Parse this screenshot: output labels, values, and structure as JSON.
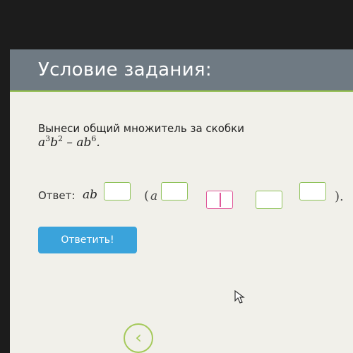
{
  "header": {
    "title": "Условие задания:"
  },
  "task": {
    "instruction": "Вынеси общий множитель за скобки",
    "expr": {
      "a1": "a",
      "e1": "3",
      "b1": "b",
      "e2": "2",
      "minus": " – ",
      "a2": "a",
      "b2": "b",
      "e3": "6",
      "dot": "."
    }
  },
  "answer": {
    "label": "Ответ:",
    "factor": "ab",
    "open_paren": "(",
    "inner_var": "a",
    "close_paren": ")."
  },
  "submit_label": "Ответить!",
  "back_icon": "chevron-left-icon",
  "colors": {
    "header": "#6f7a83",
    "accent_green": "#8fc25a",
    "button": "#3aa3db",
    "focus": "#e0589a"
  }
}
